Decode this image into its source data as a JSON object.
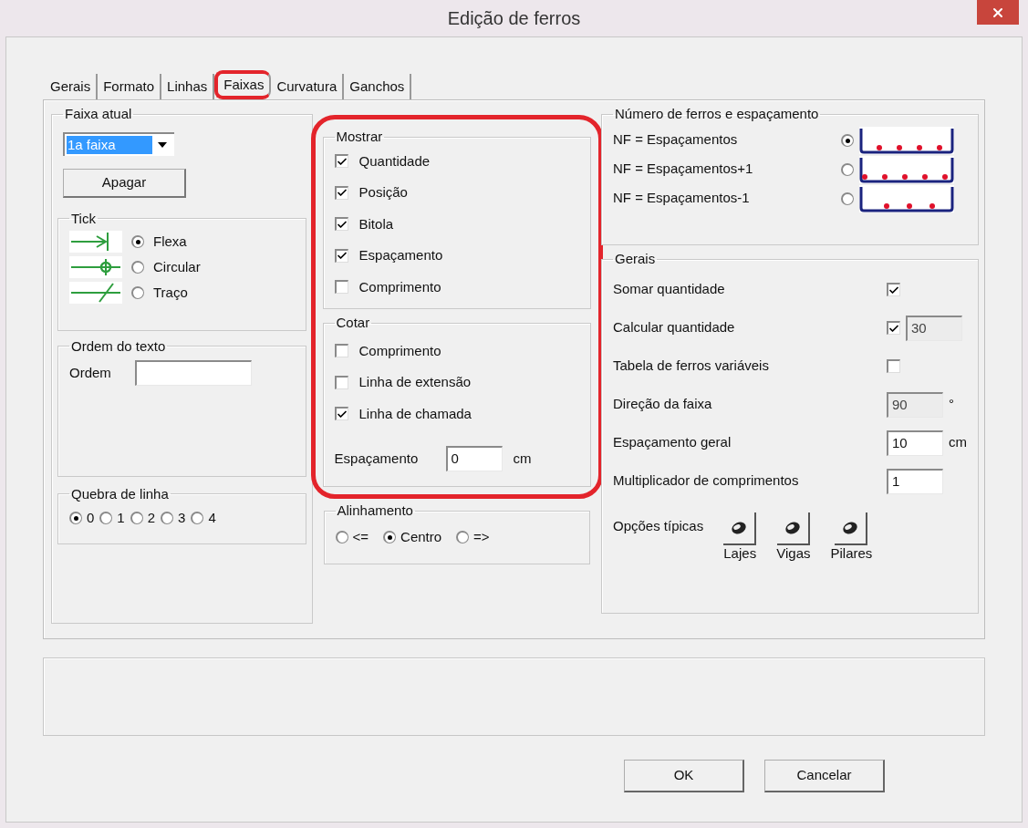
{
  "window": {
    "title": "Edição de ferros"
  },
  "tabs": [
    {
      "label": "Gerais",
      "selected": false,
      "highlighted": false
    },
    {
      "label": "Formato",
      "selected": false,
      "highlighted": false
    },
    {
      "label": "Linhas",
      "selected": false,
      "highlighted": false
    },
    {
      "label": "Faixas",
      "selected": true,
      "highlighted": true
    },
    {
      "label": "Curvatura",
      "selected": false,
      "highlighted": false
    },
    {
      "label": "Ganchos",
      "selected": false,
      "highlighted": false
    }
  ],
  "faixa_atual": {
    "title": "Faixa atual",
    "dropdown": {
      "value": "1a faixa"
    },
    "delete_button": "Apagar",
    "tick": {
      "title": "Tick",
      "options": [
        {
          "label": "Flexa",
          "kind": "arrow",
          "selected": true
        },
        {
          "label": "Circular",
          "kind": "circle",
          "selected": false
        },
        {
          "label": "Traço",
          "kind": "slash",
          "selected": false
        }
      ]
    },
    "ordem": {
      "title": "Ordem do texto",
      "label": "Ordem"
    },
    "quebra": {
      "title": "Quebra de linha",
      "options": [
        {
          "label": "0",
          "selected": true
        },
        {
          "label": "1",
          "selected": false
        },
        {
          "label": "2",
          "selected": false
        },
        {
          "label": "3",
          "selected": false
        },
        {
          "label": "4",
          "selected": false
        }
      ]
    }
  },
  "middle": {
    "highlighted": true,
    "mostrar": {
      "title": "Mostrar",
      "items": [
        {
          "label": "Quantidade",
          "checked": true
        },
        {
          "label": "Posição",
          "checked": true
        },
        {
          "label": "Bitola",
          "checked": true
        },
        {
          "label": "Espaçamento",
          "checked": true
        },
        {
          "label": "Comprimento",
          "checked": false
        }
      ]
    },
    "cotar": {
      "title": "Cotar",
      "items": [
        {
          "label": "Comprimento",
          "checked": false
        },
        {
          "label": "Linha de extensão",
          "checked": false
        },
        {
          "label": "Linha de chamada",
          "checked": true
        }
      ],
      "spacing": {
        "label": "Espaçamento",
        "value": "0",
        "unit": "cm"
      }
    },
    "alinhamento": {
      "title": "Alinhamento",
      "options": [
        {
          "label": "<=",
          "selected": false
        },
        {
          "label": "Centro",
          "selected": true
        },
        {
          "label": "=>",
          "selected": false
        }
      ]
    }
  },
  "numero": {
    "title": "Número de ferros e espaçamento",
    "options": [
      {
        "label": "NF = Espaçamentos",
        "selected": true,
        "kind": "even"
      },
      {
        "label": "NF = Espaçamentos+1",
        "selected": false,
        "kind": "edges"
      },
      {
        "label": "NF = Espaçamentos-1",
        "selected": false,
        "kind": "inset"
      }
    ]
  },
  "gerais": {
    "title": "Gerais",
    "rows": [
      {
        "kind": "check",
        "label": "Somar quantidade",
        "checked": true
      },
      {
        "kind": "check_field",
        "label": "Calcular quantidade",
        "checked": true,
        "value": "30",
        "disabled": true
      },
      {
        "kind": "check",
        "label": "Tabela de ferros variáveis",
        "checked": false
      },
      {
        "kind": "field",
        "label": "Direção da faixa",
        "value": "90",
        "unit": "°",
        "disabled": true
      },
      {
        "kind": "field",
        "label": "Espaçamento geral",
        "value": "10",
        "unit": "cm",
        "disabled": false
      },
      {
        "kind": "field",
        "label": "Multiplicador de comprimentos",
        "value": "1",
        "disabled": false
      }
    ],
    "typical": {
      "label": "Opções típicas",
      "buttons": [
        "Lajes",
        "Vigas",
        "Pilares"
      ]
    }
  },
  "buttons": [
    "OK",
    "Cancelar"
  ]
}
